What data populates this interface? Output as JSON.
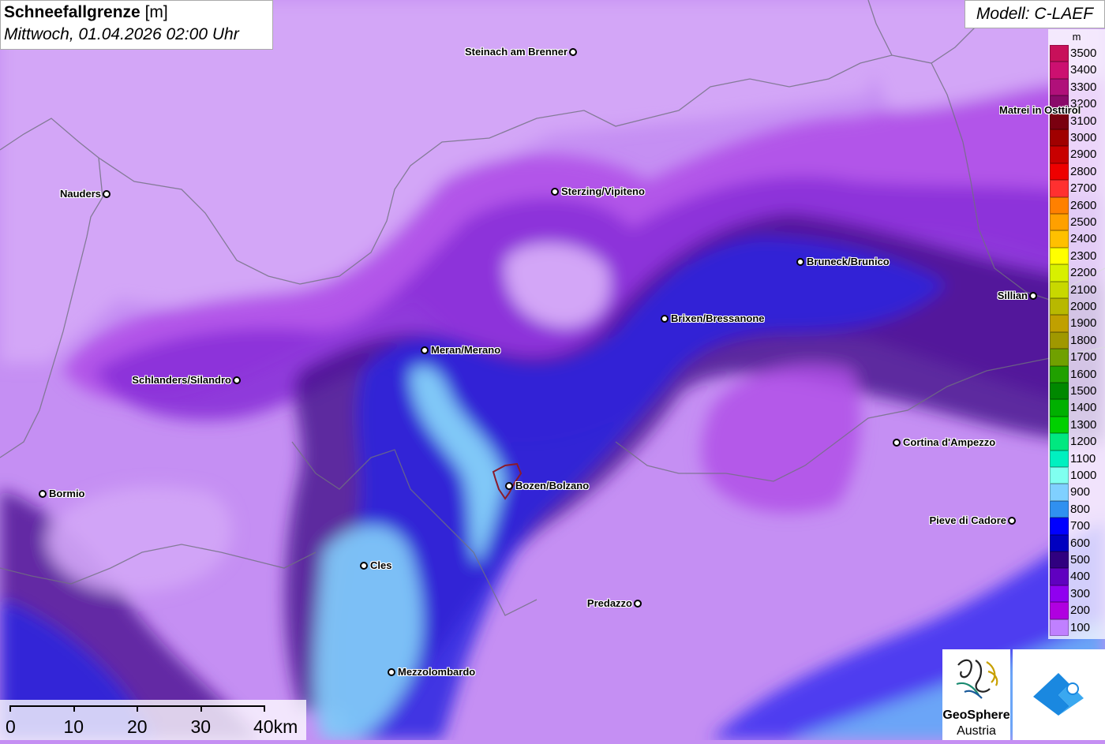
{
  "header": {
    "title_bold": "Schneefallgrenze",
    "title_unit": "[m]",
    "datetime": "Mittwoch, 01.04.2026 02:00 Uhr"
  },
  "model_label": "Modell: C-LAEF",
  "legend": {
    "unit": "m",
    "entries": [
      {
        "value": "3500",
        "color": "#c8105a"
      },
      {
        "value": "3400",
        "color": "#cc1070"
      },
      {
        "value": "3300",
        "color": "#b0107a"
      },
      {
        "value": "3200",
        "color": "#8a0a6a"
      },
      {
        "value": "3100",
        "color": "#7a0010"
      },
      {
        "value": "3000",
        "color": "#a00000"
      },
      {
        "value": "2900",
        "color": "#c80000"
      },
      {
        "value": "2800",
        "color": "#ee0000"
      },
      {
        "value": "2700",
        "color": "#ff3030"
      },
      {
        "value": "2600",
        "color": "#ff8000"
      },
      {
        "value": "2500",
        "color": "#ffa000"
      },
      {
        "value": "2400",
        "color": "#ffc000"
      },
      {
        "value": "2300",
        "color": "#ffff00"
      },
      {
        "value": "2200",
        "color": "#d8f000"
      },
      {
        "value": "2100",
        "color": "#c8d800"
      },
      {
        "value": "2000",
        "color": "#b8b800"
      },
      {
        "value": "1900",
        "color": "#c0a000"
      },
      {
        "value": "1800",
        "color": "#a09800"
      },
      {
        "value": "1700",
        "color": "#70a000"
      },
      {
        "value": "1600",
        "color": "#20a000"
      },
      {
        "value": "1500",
        "color": "#008800"
      },
      {
        "value": "1400",
        "color": "#00b000"
      },
      {
        "value": "1300",
        "color": "#00d000"
      },
      {
        "value": "1200",
        "color": "#00e880"
      },
      {
        "value": "1100",
        "color": "#00f0c0"
      },
      {
        "value": "1000",
        "color": "#80fff0"
      },
      {
        "value": "900",
        "color": "#80d0ff"
      },
      {
        "value": "800",
        "color": "#3090f0"
      },
      {
        "value": "700",
        "color": "#0000ff"
      },
      {
        "value": "600",
        "color": "#0000c0"
      },
      {
        "value": "500",
        "color": "#300080"
      },
      {
        "value": "400",
        "color": "#6000c0"
      },
      {
        "value": "300",
        "color": "#9000f0"
      },
      {
        "value": "200",
        "color": "#b000e0"
      },
      {
        "value": "100",
        "color": "#c080ff"
      }
    ]
  },
  "cities": [
    {
      "name": "Steinach am Brenner",
      "side": "left"
    },
    {
      "name": "Nauders",
      "side": "left"
    },
    {
      "name": "Sterzing/Vipiteno",
      "side": "right"
    },
    {
      "name": "Matrei in Osttirol",
      "side": "left"
    },
    {
      "name": "Bruneck/Brunico",
      "side": "right"
    },
    {
      "name": "Sillian",
      "side": "left"
    },
    {
      "name": "Brixen/Bressanone",
      "side": "right"
    },
    {
      "name": "Meran/Merano",
      "side": "right"
    },
    {
      "name": "Schlanders/Silandro",
      "side": "left"
    },
    {
      "name": "Cortina d'Ampezzo",
      "side": "right"
    },
    {
      "name": "Bormio",
      "side": "right"
    },
    {
      "name": "Bozen/Bolzano",
      "side": "right"
    },
    {
      "name": "Pieve di Cadore",
      "side": "left"
    },
    {
      "name": "Cles",
      "side": "right"
    },
    {
      "name": "Predazzo",
      "side": "left"
    },
    {
      "name": "Mezzolombardo",
      "side": "right"
    }
  ],
  "scale_bar": {
    "labels": [
      "0",
      "10",
      "20",
      "30",
      "40km"
    ]
  },
  "logo": {
    "line1": "GeoSphere",
    "line2": "Austria"
  }
}
